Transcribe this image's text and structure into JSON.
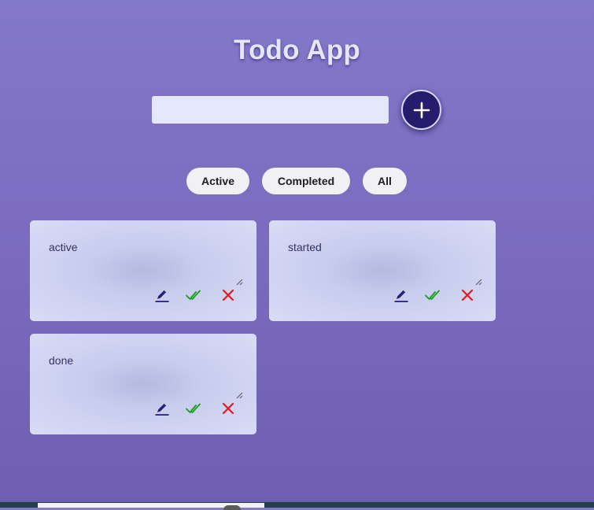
{
  "header": {
    "title": "Todo App"
  },
  "new_todo": {
    "value": "",
    "placeholder": ""
  },
  "add_button": {
    "icon": "plus-icon"
  },
  "filters": [
    "Active",
    "Completed",
    "All"
  ],
  "todos": [
    {
      "text": "active"
    },
    {
      "text": "started"
    },
    {
      "text": "done"
    }
  ],
  "actions": {
    "edit_icon": "pencil-icon",
    "complete_icon": "double-check-icon",
    "delete_icon": "close-icon"
  },
  "colors": {
    "background_top": "#8478c9",
    "background_bottom": "#6f5fb1",
    "accent": "#261b6c",
    "edit": "#2b2277",
    "complete": "#1aa21f",
    "delete": "#e11a1a"
  }
}
